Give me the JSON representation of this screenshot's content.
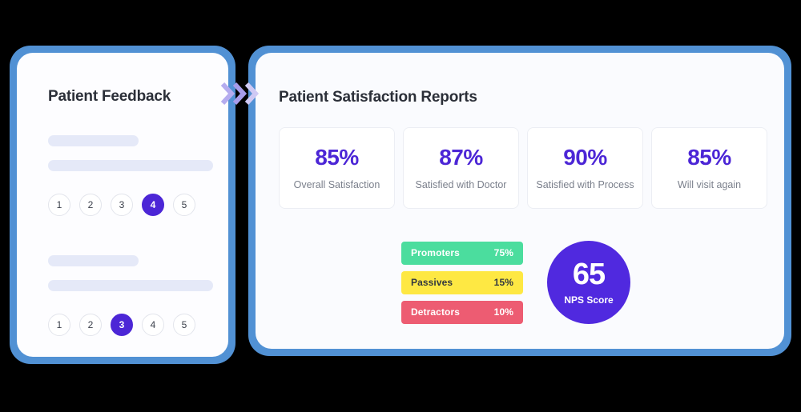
{
  "theme": {
    "frame_blue": "#5191d4",
    "accent_purple": "#4c26d6",
    "nps_purple": "#5029df",
    "placeholder_lavender": "#e5e9f8",
    "promoters_green": "#4bdd9e",
    "passives_yellow": "#fee843",
    "detractors_red": "#ed5c72",
    "page_background": "#000000"
  },
  "left_panel": {
    "title": "Patient Feedback",
    "feedback_items": [
      {
        "rating_options": [
          "1",
          "2",
          "3",
          "4",
          "5"
        ],
        "selected": "4"
      },
      {
        "rating_options": [
          "1",
          "2",
          "3",
          "4",
          "5"
        ],
        "selected": "3"
      }
    ]
  },
  "transition": {
    "icon": "double-chevron-right-icon"
  },
  "right_panel": {
    "title": "Patient Satisfaction Reports",
    "stats": [
      {
        "value": "85%",
        "label": "Overall Satisfaction"
      },
      {
        "value": "87%",
        "label": "Satisfied with Doctor"
      },
      {
        "value": "90%",
        "label": "Satisfied with Process"
      },
      {
        "value": "85%",
        "label": "Will visit again"
      }
    ],
    "nps": {
      "score": "65",
      "caption": "NPS Score",
      "segments": [
        {
          "name": "Promoters",
          "percent": "75%"
        },
        {
          "name": "Passives",
          "percent": "15%"
        },
        {
          "name": "Detractors",
          "percent": "10%"
        }
      ]
    }
  },
  "chart_data": {
    "type": "bar",
    "title": "Patient Satisfaction Reports",
    "categories": [
      "Promoters",
      "Passives",
      "Detractors"
    ],
    "values": [
      75,
      15,
      10
    ],
    "value_labels": [
      "75%",
      "15%",
      "10%"
    ],
    "colors": [
      "#4bdd9e",
      "#fee843",
      "#ed5c72"
    ],
    "xlabel": "",
    "ylabel": "",
    "ylim": [
      0,
      100
    ],
    "grid": false,
    "legend": "none",
    "annotations": [
      {
        "label": "NPS Score",
        "value": 65
      },
      {
        "label": "Overall Satisfaction",
        "value": 85
      },
      {
        "label": "Satisfied with Doctor",
        "value": 87
      },
      {
        "label": "Satisfied with Process",
        "value": 90
      },
      {
        "label": "Will visit again",
        "value": 85
      }
    ]
  }
}
